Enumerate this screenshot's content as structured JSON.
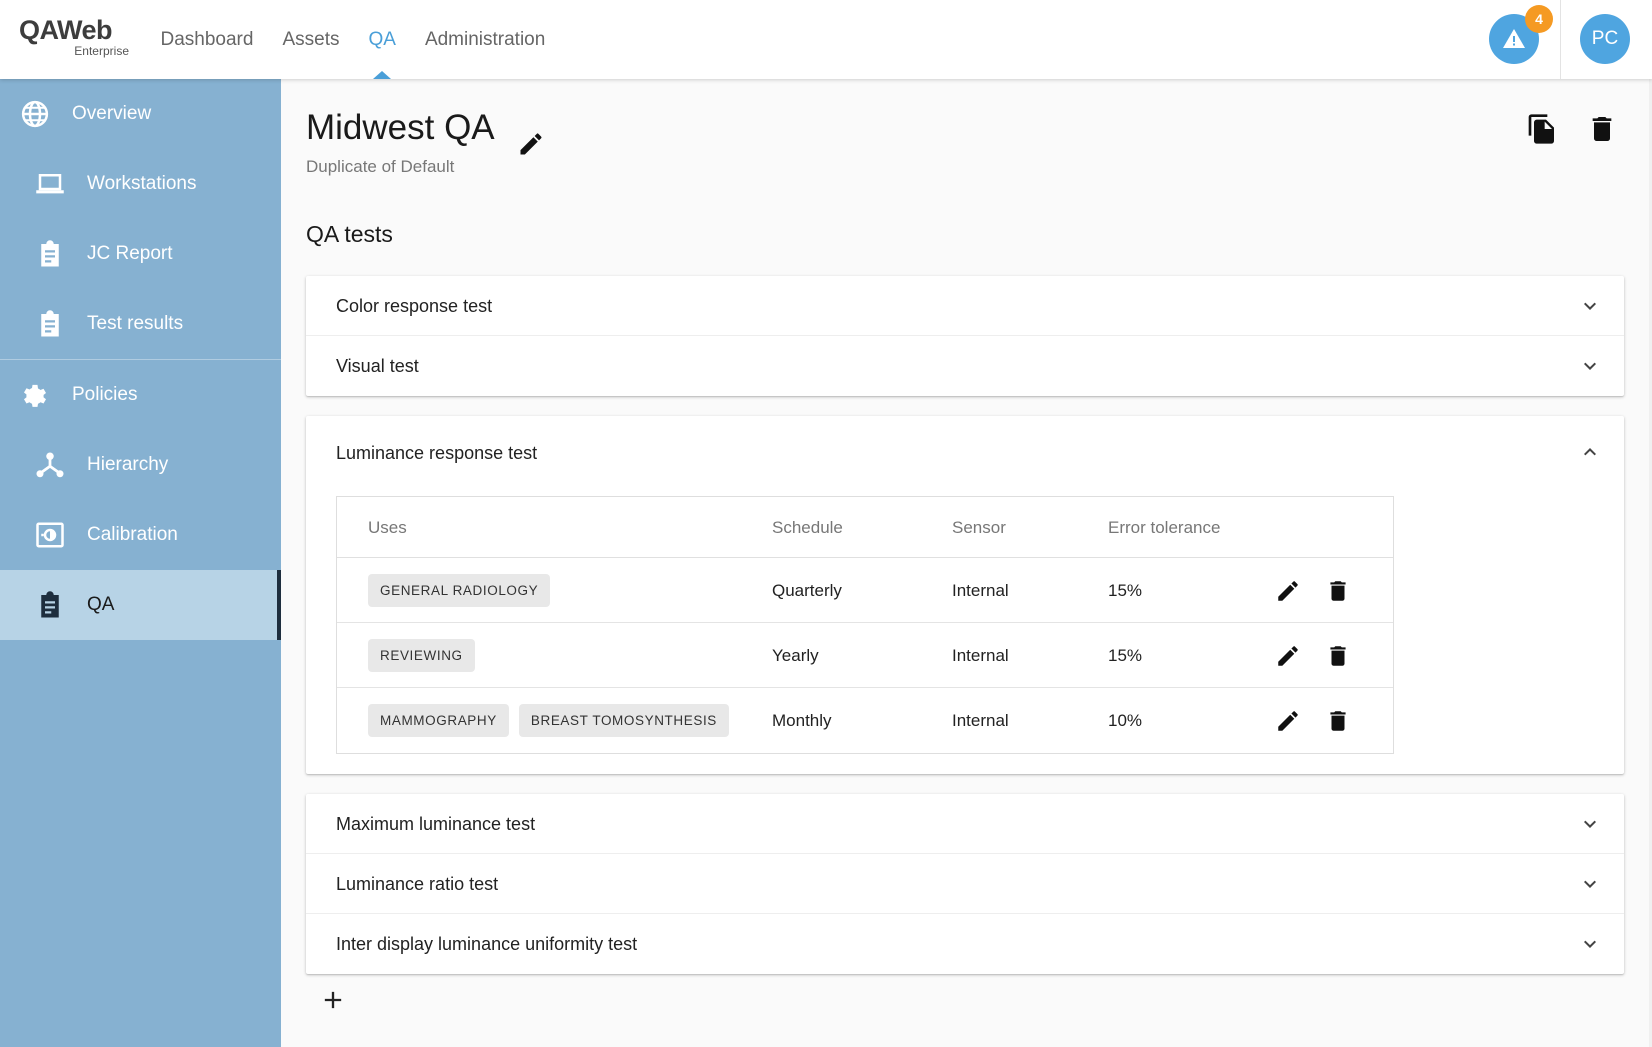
{
  "brand": {
    "name_bold": "QA",
    "name_thin": "Web",
    "edition": "Enterprise"
  },
  "nav": {
    "items": [
      {
        "label": "Dashboard",
        "active": false
      },
      {
        "label": "Assets",
        "active": false
      },
      {
        "label": "QA",
        "active": true
      },
      {
        "label": "Administration",
        "active": false
      }
    ]
  },
  "header": {
    "alert_count": "4",
    "avatar_initials": "PC",
    "accent_color": "#4fa5e0",
    "badge_color": "#f59a23"
  },
  "sidebar": {
    "items": [
      {
        "label": "Overview",
        "icon": "globe-icon"
      },
      {
        "label": "Workstations",
        "icon": "laptop-icon"
      },
      {
        "label": "JC Report",
        "icon": "clipboard-icon"
      },
      {
        "label": "Test results",
        "icon": "clipboard-icon"
      },
      {
        "label": "Policies",
        "icon": "gear-icon"
      },
      {
        "label": "Hierarchy",
        "icon": "hierarchy-icon"
      },
      {
        "label": "Calibration",
        "icon": "calibration-icon"
      },
      {
        "label": "QA",
        "icon": "clipboard-check-icon",
        "active": true
      }
    ],
    "background_color": "#86b1d1",
    "active_color": "#b7d3e6"
  },
  "policy": {
    "title": "Midwest QA",
    "subtitle": "Duplicate of Default"
  },
  "qa_tests": {
    "section_title": "QA tests",
    "group_top": [
      "Color response test",
      "Visual test"
    ],
    "expanded": {
      "title": "Luminance response test",
      "columns": {
        "uses": "Uses",
        "schedule": "Schedule",
        "sensor": "Sensor",
        "tolerance": "Error tolerance"
      },
      "rows": [
        {
          "uses": [
            "GENERAL RADIOLOGY"
          ],
          "schedule": "Quarterly",
          "sensor": "Internal",
          "tolerance": "15%"
        },
        {
          "uses": [
            "REVIEWING"
          ],
          "schedule": "Yearly",
          "sensor": "Internal",
          "tolerance": "15%"
        },
        {
          "uses": [
            "MAMMOGRAPHY",
            "BREAST TOMOSYNTHESIS"
          ],
          "schedule": "Monthly",
          "sensor": "Internal",
          "tolerance": "10%"
        }
      ]
    },
    "group_bottom": [
      "Maximum luminance test",
      "Luminance ratio test",
      "Inter display luminance uniformity test"
    ]
  }
}
